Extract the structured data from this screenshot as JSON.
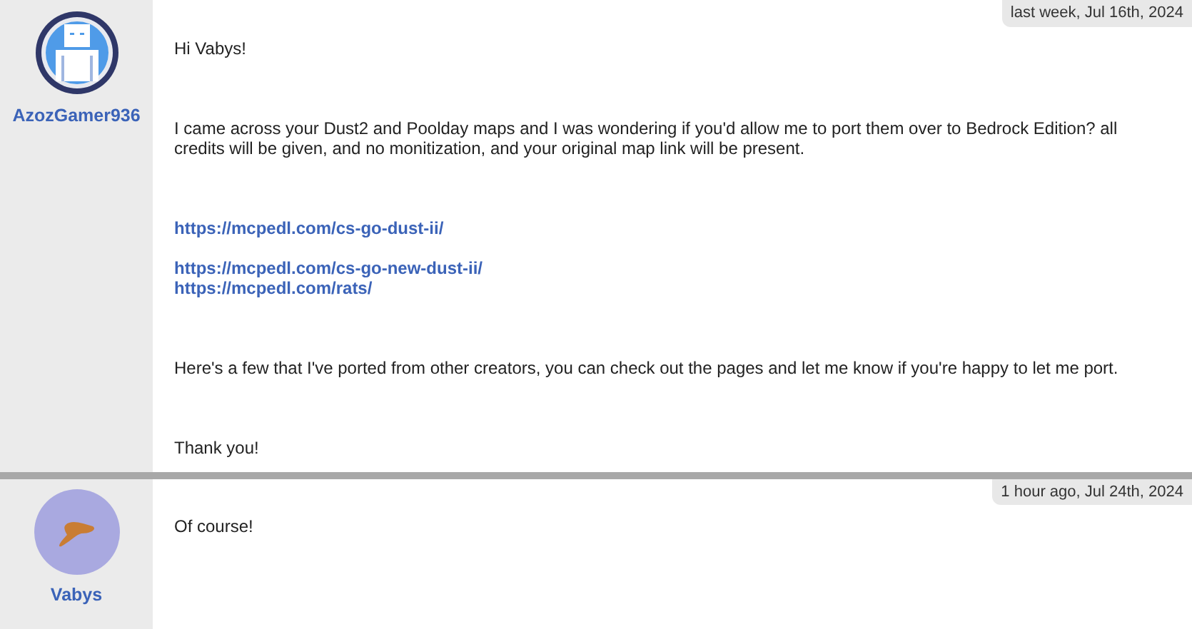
{
  "posts": [
    {
      "author": "AzozGamer936",
      "avatar": {
        "kind": "robot"
      },
      "timestamp": "last week, Jul 16th, 2024",
      "body": [
        {
          "kind": "text",
          "text": "Hi Vabys!"
        },
        {
          "kind": "text",
          "text": "I came across your Dust2 and Poolday maps and I was wondering if you'd allow me to port them over to Bedrock Edition? all credits will be given, and no monitization, and your original map link will be present."
        },
        {
          "kind": "links",
          "groups": [
            [
              "https://mcpedl.com/cs-go-dust-ii/"
            ],
            [
              "https://mcpedl.com/cs-go-new-dust-ii/",
              "https://mcpedl.com/rats/"
            ]
          ]
        },
        {
          "kind": "text",
          "text": "Here's a few that I've ported from other creators, you can check out the pages and let me know if you're happy to let me port."
        },
        {
          "kind": "text",
          "text": "Thank you!"
        }
      ]
    },
    {
      "author": "Vabys",
      "avatar": {
        "kind": "blob"
      },
      "timestamp": "1 hour ago, Jul 24th, 2024",
      "body": [
        {
          "kind": "text",
          "text": "Of course!"
        }
      ]
    }
  ]
}
